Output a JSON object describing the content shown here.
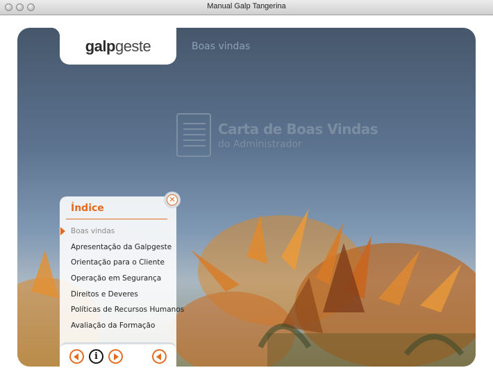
{
  "window": {
    "title": "Manual Galp Tangerina"
  },
  "header": {
    "logo_bold": "galp",
    "logo_light": "geste",
    "section_title": "Boas vindas"
  },
  "letter": {
    "title": "Carta de Boas Vindas",
    "subtitle": "do Administrador"
  },
  "index": {
    "title": "Índice",
    "close_symbol": "✕",
    "items": [
      {
        "label": "Boas vindas",
        "active": true
      },
      {
        "label": "Apresentação da Galpgeste",
        "active": false
      },
      {
        "label": "Orientação para o Cliente",
        "active": false
      },
      {
        "label": "Operação em Segurança",
        "active": false
      },
      {
        "label": "Direitos e Deveres",
        "active": false
      },
      {
        "label": "Políticas de Recursos Humanos",
        "active": false
      },
      {
        "label": "Avaliação da Formação",
        "active": false
      }
    ]
  },
  "nav": {
    "info_symbol": "i",
    "icons": [
      "prev-icon",
      "info-icon",
      "next-icon",
      "back-icon"
    ]
  },
  "colors": {
    "accent": "#e36a1e",
    "sky_top": "#46576b",
    "sky_mid": "#7f98b3"
  }
}
